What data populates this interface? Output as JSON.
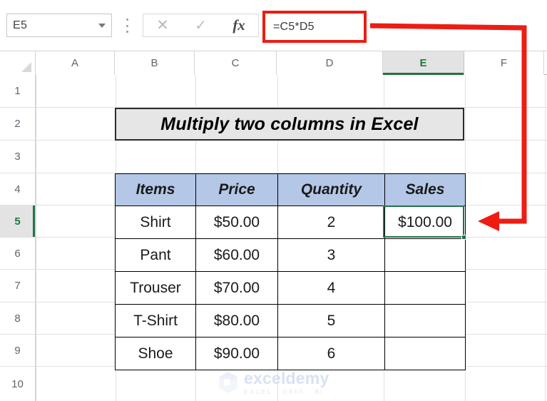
{
  "app": {
    "name_box_value": "E5",
    "name_box_dropdown_icon": "chevron-down-icon",
    "separator_icon": "vertical-dots-icon",
    "cancel_icon": "cancel-x-icon",
    "confirm_icon": "checkmark-icon",
    "insert_function_icon": "fx-icon",
    "cancel_glyph": "✕",
    "confirm_glyph": "✓",
    "fx_glyph": "fx",
    "formula_value": "=C5*D5",
    "formula_placeholder": ""
  },
  "grid": {
    "column_headers": [
      "A",
      "B",
      "C",
      "D",
      "E",
      "F"
    ],
    "selected_column": "E",
    "row_headers": [
      "1",
      "2",
      "3",
      "4",
      "5",
      "6",
      "7",
      "8",
      "9",
      "10"
    ],
    "selected_row": "5",
    "select_all_icon": "select-all-triangle-icon"
  },
  "sheet": {
    "title": "Multiply two columns in Excel",
    "table": {
      "headers": [
        "Items",
        "Price",
        "Quantity",
        "Sales"
      ],
      "rows": [
        [
          "Shirt",
          "$50.00",
          "2",
          "$100.00"
        ],
        [
          "Pant",
          "$60.00",
          "3",
          ""
        ],
        [
          "Trouser",
          "$70.00",
          "4",
          ""
        ],
        [
          "T-Shirt",
          "$80.00",
          "5",
          ""
        ],
        [
          "Shoe",
          "$90.00",
          "6",
          ""
        ]
      ]
    },
    "selected_cell": "E5",
    "fill_handle_icon": "fill-handle-icon"
  },
  "annotation": {
    "shape": "red-elbow-arrow",
    "color": "#ee1c13",
    "points_from": "formula bar",
    "points_to": "cell E5"
  },
  "watermark": {
    "brand": "exceldemy",
    "tagline": "EXCEL · DATA · BI",
    "logo_icon": "exceldemy-cube-logo-icon"
  },
  "colors": {
    "selection_green": "#217346",
    "header_fill_blue": "#b4c7e7",
    "title_fill_gray": "#e6e6e6",
    "annotation_red": "#ee1c13"
  }
}
